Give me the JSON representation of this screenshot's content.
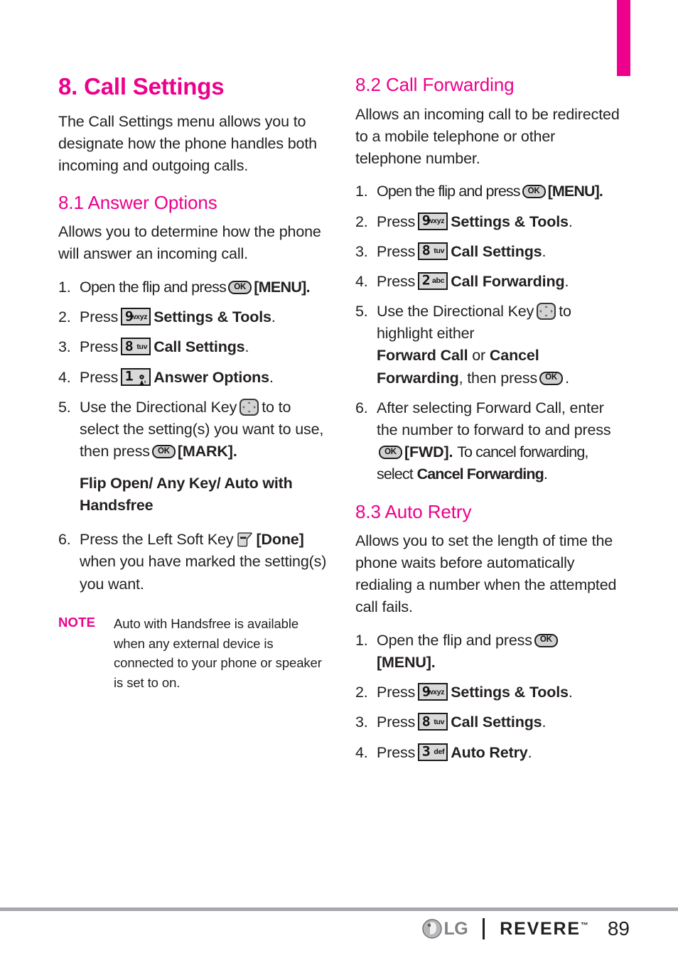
{
  "page": {
    "number": "89",
    "accent_color": "#ec008c",
    "text_color": "#231f20",
    "footer_rule_color": "#a6a8ab"
  },
  "tab_marker": {
    "color": "#ec008c"
  },
  "chapter": {
    "title": "8. Call Settings",
    "intro": "The Call Settings menu allows you to designate how the phone handles both incoming and outgoing calls."
  },
  "sections": {
    "answer_options": {
      "heading": "8.1 Answer Options",
      "intro": "Allows you to determine how the phone will answer an incoming call.",
      "steps": {
        "s1_num": "1.",
        "s1_a": "Open the flip and press",
        "s1_b": "[MENU].",
        "s2_num": "2.",
        "s2_a": "Press",
        "s2_b": "Settings & Tools",
        "s2_c": ".",
        "s3_num": "3.",
        "s3_a": "Press",
        "s3_b": "Call Settings",
        "s3_c": ".",
        "s4_num": "4.",
        "s4_a": "Press",
        "s4_b": "Answer Options",
        "s4_c": ".",
        "s5_num": "5.",
        "s5_a": "Use the Directional Key",
        "s5_b": "to to select the setting(s) you want to use, then press",
        "s5_c": "[MARK].",
        "s6_num": "6.",
        "s6_a": "Press the Left Soft Key",
        "s6_b": "[Done]",
        "s6_c": "when you have marked the setting(s) you want."
      },
      "options_line": "Flip Open/ Any Key/ Auto with Handsfree",
      "note": {
        "label": "NOTE",
        "text": "Auto with Handsfree is available when any external device is connected to your phone or speaker is set to on."
      }
    },
    "call_forwarding": {
      "heading": "8.2 Call Forwarding",
      "intro": "Allows an incoming call to be redirected to a mobile telephone or other telephone number.",
      "steps": {
        "s1_num": "1.",
        "s1_a": "Open the flip and press",
        "s1_b": "[MENU].",
        "s2_num": "2.",
        "s2_a": "Press",
        "s2_b": "Settings & Tools",
        "s2_c": ".",
        "s3_num": "3.",
        "s3_a": "Press",
        "s3_b": "Call Settings",
        "s3_c": ".",
        "s4_num": "4.",
        "s4_a": "Press",
        "s4_b": "Call Forwarding",
        "s4_c": ".",
        "s5_num": "5.",
        "s5_a": "Use the Directional Key",
        "s5_b": "to highlight either",
        "s5_c": "Forward Call",
        "s5_d": "or",
        "s5_e": "Cancel Forwarding",
        "s5_f": ", then press",
        "s5_g": ".",
        "s6_num": "6.",
        "s6_a": "After selecting Forward Call, enter the number to forward to and press",
        "s6_b": "[FWD].",
        "s6_c": "To cancel forwarding, select",
        "s6_d": "Cancel Forwarding",
        "s6_e": "."
      }
    },
    "auto_retry": {
      "heading": "8.3 Auto Retry",
      "intro": "Allows you to set the length of time the phone waits before automatically redialing a number when the attempted call fails.",
      "steps": {
        "s1_num": "1.",
        "s1_a": "Open the flip and press",
        "s1_b": "[MENU].",
        "s2_num": "2.",
        "s2_a": "Press",
        "s2_b": "Settings & Tools",
        "s2_c": ".",
        "s3_num": "3.",
        "s3_a": "Press",
        "s3_b": "Call Settings",
        "s3_c": ".",
        "s4_num": "4.",
        "s4_a": "Press",
        "s4_b": "Auto Retry",
        "s4_c": "."
      }
    }
  },
  "keys": {
    "ok": "OK",
    "k1_digit": "1",
    "k1_sub": "",
    "k2_digit": "2",
    "k2_sub": "abc",
    "k3_digit": "3",
    "k3_sub": "def",
    "k8_digit": "8",
    "k8_sub": "tuv",
    "k9_digit": "9",
    "k9_sub": "wxyz"
  },
  "footer": {
    "brand": "LG",
    "model": "REVERE",
    "trademark": "™",
    "page_number": "89"
  }
}
